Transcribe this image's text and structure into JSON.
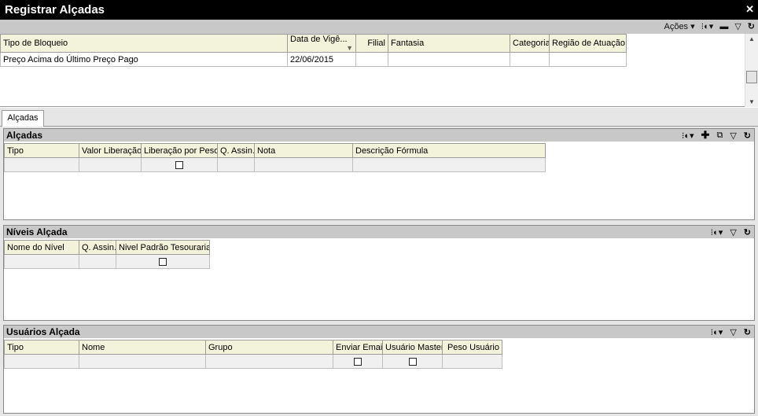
{
  "window": {
    "title": "Registrar Alçadas",
    "close_glyph": "✕"
  },
  "main_toolbar": {
    "acoes_label": "Ações",
    "icons": [
      "filter-dots-icon",
      "minimize-icon",
      "filter-icon",
      "refresh-icon"
    ]
  },
  "top_grid": {
    "columns": [
      "Tipo de Bloqueio",
      "Data de Vigê...",
      "Filial",
      "Fantasia",
      "Categoria",
      "Região de Atuação"
    ],
    "rows": [
      [
        "Preço Acima do Último Preço Pago",
        "22/06/2015",
        "",
        "",
        "",
        ""
      ]
    ]
  },
  "tabs": [
    {
      "label": "Alçadas"
    }
  ],
  "alcadas_panel": {
    "title": "Alçadas",
    "columns": [
      "Tipo",
      "Valor Liberação",
      "Liberação por Peso",
      "Q. Assin.",
      "Nota",
      "Descrição Fórmula"
    ],
    "checkbox_column": 2
  },
  "niveis_panel": {
    "title": "Níveis Alçada",
    "columns": [
      "Nome do Nível",
      "Q. Assin.",
      "Nivel Padrão Tesouraria"
    ],
    "checkbox_column": 2
  },
  "usuarios_panel": {
    "title": "Usuários Alçada",
    "columns": [
      "Tipo",
      "Nome",
      "Grupo",
      "Enviar Email",
      "Usuário Master",
      "Peso Usuário"
    ],
    "checkbox_columns": [
      3,
      4
    ]
  }
}
